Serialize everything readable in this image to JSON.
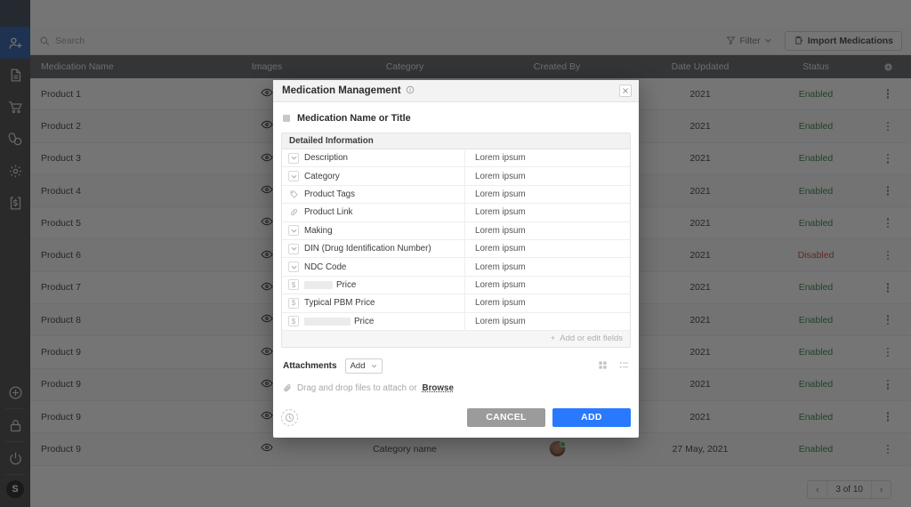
{
  "sidebar": {
    "logo_redacted": true,
    "items": [
      {
        "name": "add-user",
        "label": "Add User",
        "active": true
      },
      {
        "name": "document",
        "label": "Documents",
        "active": false
      },
      {
        "name": "cart",
        "label": "Orders",
        "active": false
      },
      {
        "name": "pills",
        "label": "Medications",
        "active": false
      },
      {
        "name": "gear",
        "label": "Settings",
        "active": false
      },
      {
        "name": "invoice",
        "label": "Billing",
        "active": false
      }
    ],
    "bottom_items": [
      {
        "name": "plus-circle",
        "label": "Add"
      },
      {
        "name": "lock",
        "label": "Lock"
      },
      {
        "name": "power",
        "label": "Log out"
      }
    ],
    "avatar_initial": "S"
  },
  "toolbar": {
    "search_placeholder": "Search",
    "search_value": "",
    "filter_label": "Filter",
    "import_label": "Import Medications"
  },
  "table": {
    "columns": [
      "Medication Name",
      "Images",
      "Category",
      "Created By",
      "Date Updated",
      "Status"
    ],
    "rows": [
      {
        "name": "Product 1",
        "category": "",
        "date": "2021",
        "date_partial": true,
        "status": "Enabled"
      },
      {
        "name": "Product 2",
        "category": "",
        "date": "2021",
        "date_partial": true,
        "status": "Enabled"
      },
      {
        "name": "Product 3",
        "category": "",
        "date": "2021",
        "date_partial": true,
        "status": "Enabled"
      },
      {
        "name": "Product 4",
        "category": "",
        "date": "2021",
        "date_partial": true,
        "status": "Enabled"
      },
      {
        "name": "Product 5",
        "category": "",
        "date": "2021",
        "date_partial": true,
        "status": "Enabled"
      },
      {
        "name": "Product 6",
        "category": "",
        "date": "2021",
        "date_partial": true,
        "status": "Disabled"
      },
      {
        "name": "Product 7",
        "category": "",
        "date": "2021",
        "date_partial": true,
        "status": "Enabled"
      },
      {
        "name": "Product 8",
        "category": "",
        "date": "2021",
        "date_partial": true,
        "status": "Enabled"
      },
      {
        "name": "Product 9",
        "category": "",
        "date": "2021",
        "date_partial": true,
        "status": "Enabled"
      },
      {
        "name": "Product 9",
        "category": "",
        "date": "2021",
        "date_partial": true,
        "status": "Enabled"
      },
      {
        "name": "Product 9",
        "category": "",
        "date": "2021",
        "date_partial": true,
        "status": "Enabled"
      },
      {
        "name": "Product 9",
        "category": "Category name",
        "date": "27 May, 2021",
        "date_partial": false,
        "status": "Enabled"
      }
    ]
  },
  "pagination": {
    "label": "3 of 10",
    "prev": "‹",
    "next": "›"
  },
  "modal": {
    "title": "Medication Management",
    "close_label": "×",
    "record_name": "Medication Name or Title",
    "fields_section_title": "Detailed Information",
    "fields": [
      {
        "icon": "chevron-box-icon",
        "label": "Description",
        "value": "Lorem ipsum",
        "redact": "none"
      },
      {
        "icon": "chevron-box-icon",
        "label": "Category",
        "value": "Lorem ipsum",
        "redact": "none"
      },
      {
        "icon": "tag-icon",
        "label": "Product Tags",
        "value": "Lorem ipsum",
        "redact": "none"
      },
      {
        "icon": "link-icon",
        "label": "Product Link",
        "value": "Lorem ipsum",
        "redact": "none"
      },
      {
        "icon": "chevron-box-icon",
        "label": "Making",
        "value": "Lorem ipsum",
        "redact": "none"
      },
      {
        "icon": "chevron-box-icon",
        "label": "DIN (Drug Identification Number)",
        "value": "Lorem ipsum",
        "redact": "none"
      },
      {
        "icon": "chevron-box-icon",
        "label": "NDC Code",
        "value": "Lorem ipsum",
        "redact": "none"
      },
      {
        "icon": "dollar-box-icon",
        "label": "Price",
        "value": "Lorem ipsum",
        "redact": "leading",
        "redact_width": 32
      },
      {
        "icon": "dollar-box-icon",
        "label": "Typical PBM Price",
        "value": "Lorem ipsum",
        "redact": "none"
      },
      {
        "icon": "dollar-box-icon",
        "label": "Price",
        "value": "Lorem ipsum",
        "redact": "leading",
        "redact_width": 52
      }
    ],
    "add_fields_label": "Add or edit fields",
    "add_fields_icon": "plus-icon",
    "attachments_label": "Attachments",
    "attachments_add_label": "Add",
    "dropzone_text": "Drag and drop files to attach or",
    "dropzone_browse": "Browse",
    "view_grid_icon": "grid-view-icon",
    "view_list_icon": "list-view-icon",
    "history_icon": "clock-icon",
    "cancel_label": "CANCEL",
    "add_label": "ADD"
  },
  "colors": {
    "accent_blue": "#2979ff",
    "sidebar_active": "#1b4fa0",
    "status_enabled": "#1b7a33",
    "status_disabled": "#c0392b",
    "cancel_gray": "#9b9b9b",
    "table_header": "#54585c"
  }
}
